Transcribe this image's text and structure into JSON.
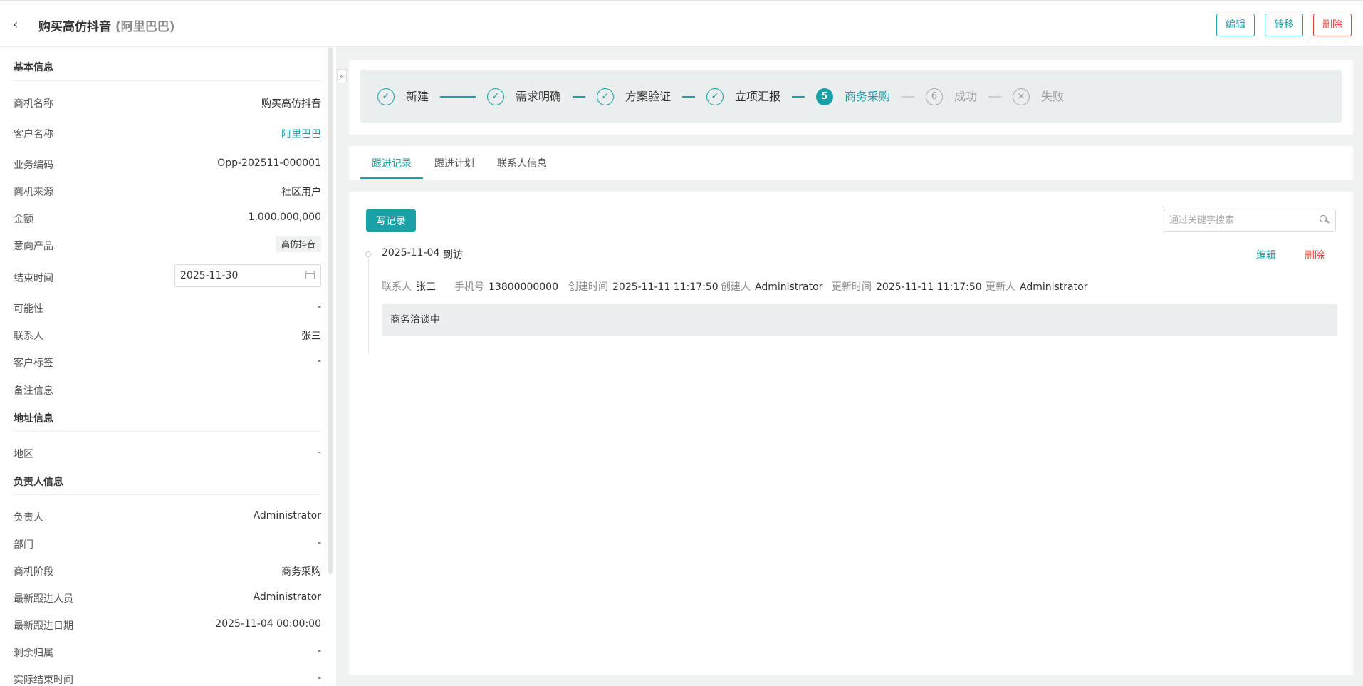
{
  "header": {
    "back_icon": "chevron-left-icon",
    "title": "购买高仿抖音",
    "title_suffix": "(阿里巴巴)",
    "edit_label": "编辑",
    "transfer_label": "转移",
    "delete_label": "删除"
  },
  "left": {
    "basic_title": "基本信息",
    "basic_rows": [
      {
        "label": "商机名称",
        "value": "购买高仿抖音"
      },
      {
        "label": "客户名称",
        "value": "阿里巴巴"
      },
      {
        "label": "业务编码",
        "value": "Opp-202511-000001"
      },
      {
        "label": "商机来源",
        "value": "社区用户"
      },
      {
        "label": "金额",
        "value": "1,000,000,000"
      },
      {
        "label": "意向产品",
        "value": "高仿抖音"
      },
      {
        "label": "结束时间",
        "value": "2025-11-30"
      },
      {
        "label": "可能性",
        "value": "-"
      },
      {
        "label": "联系人",
        "value": "张三"
      },
      {
        "label": "客户标签",
        "value": "-"
      },
      {
        "label": "备注信息",
        "value": ""
      }
    ],
    "address_title": "地址信息",
    "address_rows": [
      {
        "label": "地区",
        "value": "-"
      }
    ],
    "owner_title": "负责人信息",
    "owner_rows": [
      {
        "label": "负责人",
        "value": "Administrator"
      },
      {
        "label": "部门",
        "value": "-"
      },
      {
        "label": "商机阶段",
        "value": "商务采购"
      },
      {
        "label": "最新跟进人员",
        "value": "Administrator"
      },
      {
        "label": "最新跟进日期",
        "value": "2025-11-04 00:00:00"
      },
      {
        "label": "剩余归属",
        "value": "-"
      },
      {
        "label": "实际结束时间",
        "value": "-"
      }
    ]
  },
  "steps": [
    {
      "label": "新建",
      "state": "done",
      "mark": "✓"
    },
    {
      "label": "需求明确",
      "state": "done",
      "mark": "✓"
    },
    {
      "label": "方案验证",
      "state": "done",
      "mark": "✓"
    },
    {
      "label": "立项汇报",
      "state": "done",
      "mark": "✓"
    },
    {
      "label": "商务采购",
      "state": "current",
      "mark": "5"
    },
    {
      "label": "成功",
      "state": "pending",
      "mark": "6"
    },
    {
      "label": "失败",
      "state": "pending",
      "mark": "×"
    }
  ],
  "tabs": [
    {
      "label": "跟进记录",
      "active": true
    },
    {
      "label": "跟进计划",
      "active": false
    },
    {
      "label": "联系人信息",
      "active": false
    }
  ],
  "records": {
    "write_label": "写记录",
    "search_placeholder": "通过关键字搜索",
    "item": {
      "date": "2025-11-04",
      "type": "到访",
      "edit_label": "编辑",
      "delete_label": "删除",
      "meta": [
        {
          "key": "联系人",
          "value": "张三"
        },
        {
          "key": "手机号",
          "value": "13800000000"
        },
        {
          "key": "创建时间",
          "value": "2025-11-11 11:17:50"
        },
        {
          "key": "创建人",
          "value": "Administrator"
        },
        {
          "key": "更新时间",
          "value": "2025-11-11 11:17:50"
        },
        {
          "key": "更新人",
          "value": "Administrator"
        }
      ],
      "note": "商务洽谈中"
    }
  },
  "colors": {
    "accent": "#1aa0a6",
    "danger": "#e8443a"
  }
}
